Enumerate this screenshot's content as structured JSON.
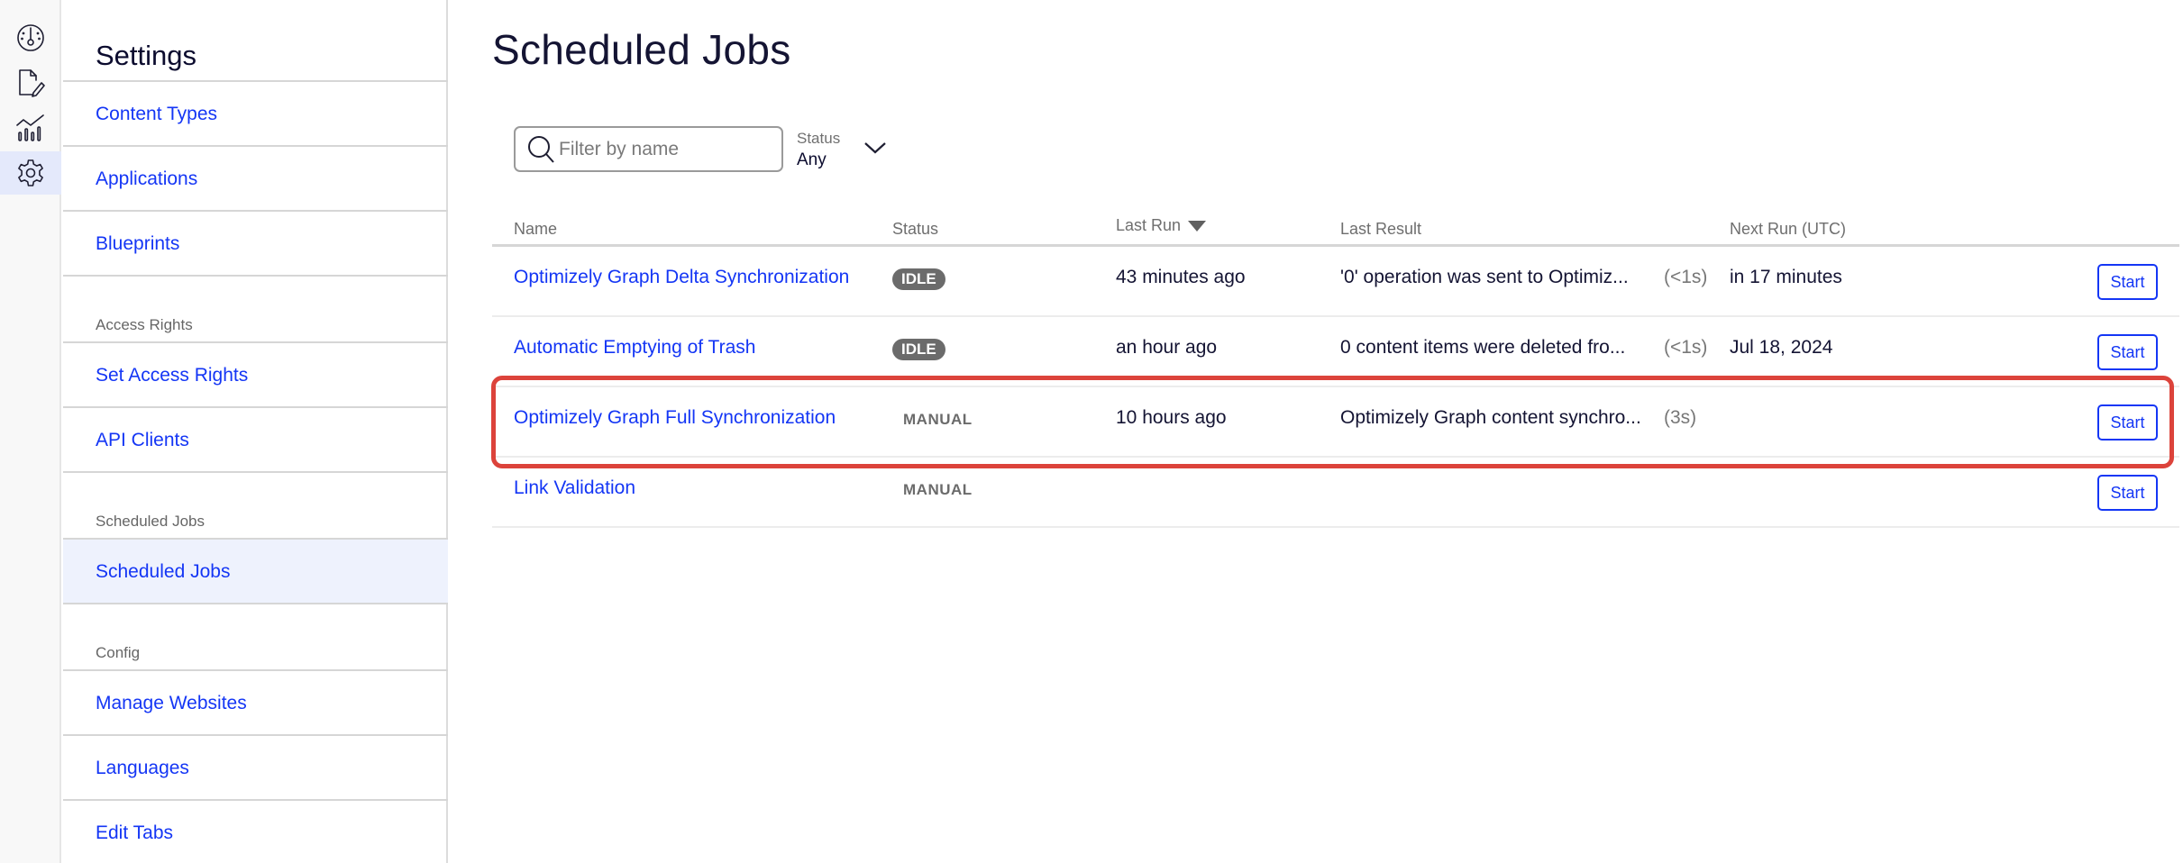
{
  "rail": {
    "items": [
      {
        "name": "dashboard",
        "icon": "gauge-icon",
        "active": false
      },
      {
        "name": "edit",
        "icon": "document-edit-icon",
        "active": false
      },
      {
        "name": "reports",
        "icon": "chart-icon",
        "active": false
      },
      {
        "name": "settings",
        "icon": "gear-icon",
        "active": true
      }
    ]
  },
  "sidebar": {
    "title": "Settings",
    "items": [
      {
        "label": "Content Types",
        "type": "link"
      },
      {
        "label": "Applications",
        "type": "link"
      },
      {
        "label": "Blueprints",
        "type": "link"
      },
      {
        "label": "Access Rights",
        "type": "group"
      },
      {
        "label": "Set Access Rights",
        "type": "link"
      },
      {
        "label": "API Clients",
        "type": "link"
      },
      {
        "label": "Scheduled Jobs",
        "type": "group"
      },
      {
        "label": "Scheduled Jobs",
        "type": "link",
        "active": true
      },
      {
        "label": "Config",
        "type": "group"
      },
      {
        "label": "Manage Websites",
        "type": "link"
      },
      {
        "label": "Languages",
        "type": "link"
      },
      {
        "label": "Edit Tabs",
        "type": "link"
      }
    ]
  },
  "main": {
    "title": "Scheduled Jobs",
    "filter": {
      "placeholder": "Filter by name",
      "value": ""
    },
    "status_filter": {
      "label": "Status",
      "value": "Any"
    },
    "columns": {
      "name": "Name",
      "status": "Status",
      "last_run": "Last Run",
      "last_result": "Last Result",
      "next_run": "Next Run (UTC)"
    },
    "sort": {
      "column": "last_run",
      "direction": "desc"
    },
    "rows": [
      {
        "name": "Optimizely Graph Delta Synchronization",
        "status": "IDLE",
        "status_style": "badge",
        "last_run": "43 minutes ago",
        "last_result": "'0' operation was sent to Optimiz...",
        "duration": "(<1s)",
        "next_run": "in 17 minutes",
        "action": "Start",
        "highlighted": false
      },
      {
        "name": "Automatic Emptying of Trash",
        "status": "IDLE",
        "status_style": "badge",
        "last_run": "an hour ago",
        "last_result": "0 content items were deleted fro...",
        "duration": "(<1s)",
        "next_run": "Jul 18, 2024",
        "action": "Start",
        "highlighted": false
      },
      {
        "name": "Optimizely Graph Full Synchronization",
        "status": "MANUAL",
        "status_style": "text",
        "last_run": "10 hours ago",
        "last_result": "Optimizely Graph content synchro...",
        "duration": "(3s)",
        "next_run": "",
        "action": "Start",
        "highlighted": true
      },
      {
        "name": "Link Validation",
        "status": "MANUAL",
        "status_style": "text",
        "last_run": "",
        "last_result": "",
        "duration": "",
        "next_run": "",
        "action": "Start",
        "highlighted": false
      }
    ]
  },
  "colors": {
    "link": "#1436f5",
    "highlight": "#dc433b",
    "active_bg": "#eef2fd",
    "badge_bg": "#6b6b6b"
  }
}
